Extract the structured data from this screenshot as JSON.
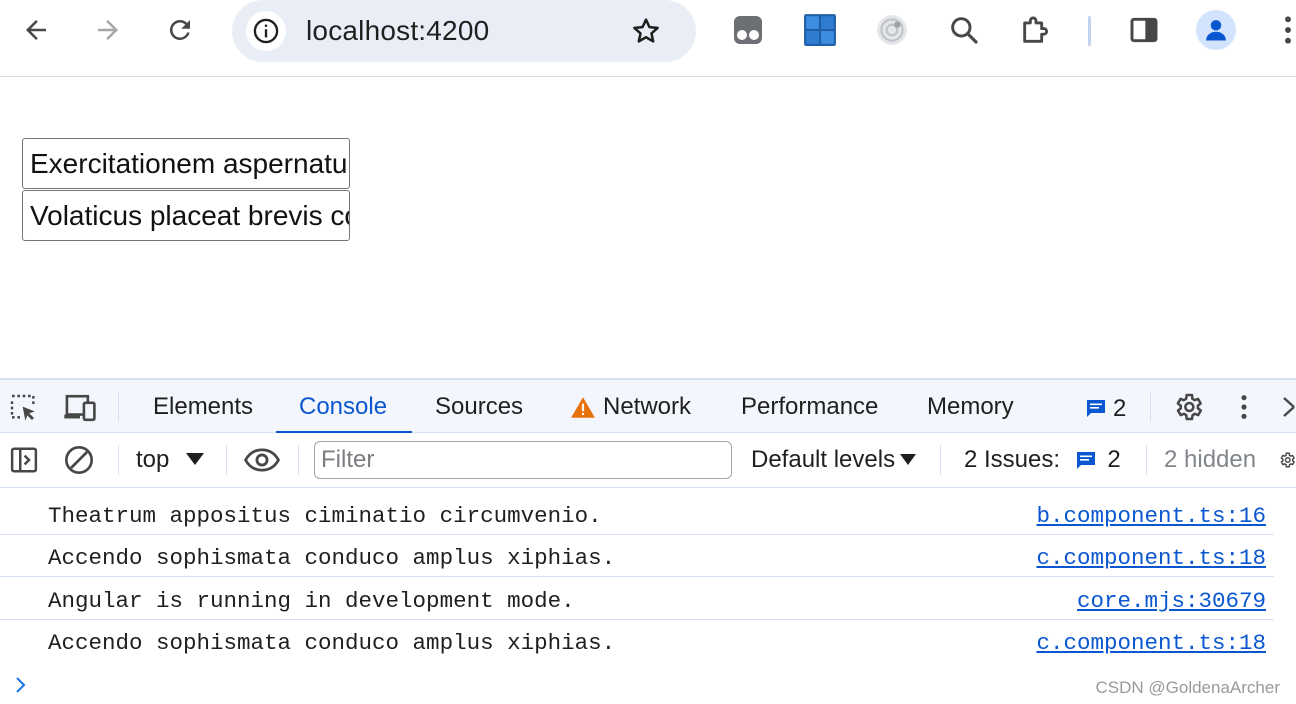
{
  "browser": {
    "url": "localhost:4200"
  },
  "page": {
    "inputs": [
      {
        "value": "Exercitationem aspernatur"
      },
      {
        "value": "Volaticus placeat brevis consequuntur"
      }
    ]
  },
  "devtools": {
    "tabs": [
      {
        "label": "Elements"
      },
      {
        "label": "Console"
      },
      {
        "label": "Sources"
      },
      {
        "label": "Network"
      },
      {
        "label": "Performance"
      },
      {
        "label": "Memory"
      }
    ],
    "active_tab": "Console",
    "message_badge_count": "2",
    "filter_bar": {
      "context": "top",
      "filter_placeholder": "Filter",
      "levels": "Default levels",
      "issues_label": "2 Issues:",
      "issues_count": "2",
      "hidden": "2 hidden"
    },
    "messages": [
      {
        "text": "Theatrum appositus ciminatio circumvenio.",
        "source": "b.component.ts:16"
      },
      {
        "text": "Accendo sophismata conduco amplus xiphias.",
        "source": "c.component.ts:18"
      },
      {
        "text": "Angular is running in development mode.",
        "source": "core.mjs:30679"
      },
      {
        "text": "Accendo sophismata conduco amplus xiphias.",
        "source": "c.component.ts:18"
      }
    ]
  },
  "watermark": "CSDN @GoldenaArcher",
  "colors": {
    "accent": "#0b57d0",
    "warning": "#e8710a",
    "toolbar_bg": "#e9eef6",
    "devtools_bg": "#f3f6fc"
  }
}
